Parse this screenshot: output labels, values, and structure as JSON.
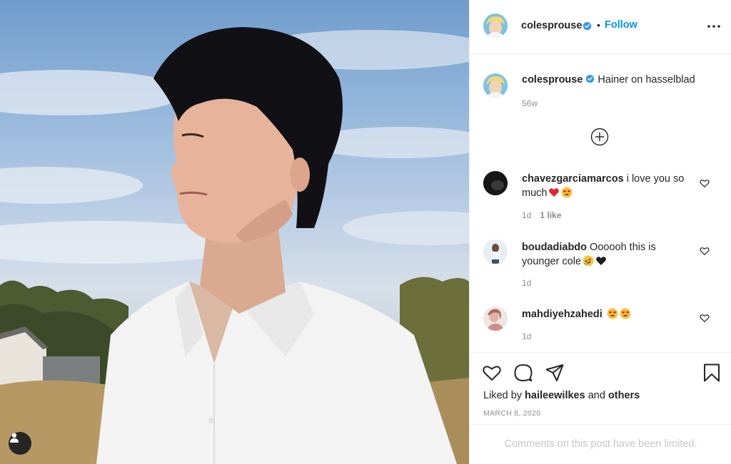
{
  "post": {
    "author": "colesprouse",
    "follow_label": "Follow",
    "separator": "•",
    "caption_text": "Hainer on hasselblad",
    "caption_age": "56w"
  },
  "comments": [
    {
      "username": "chavezgarciamarcos",
      "text": "i love you so much",
      "emojis": [
        "red-heart",
        "heart-eyes"
      ],
      "age": "1d",
      "likes": "1 like"
    },
    {
      "username": "boudadiabdo",
      "text": "Oooooh this is younger cole",
      "emojis": [
        "rolling-laughing",
        "black-heart"
      ],
      "age": "1d",
      "likes": ""
    },
    {
      "username": "mahdiyehzahedi",
      "text": "",
      "emojis": [
        "heart-eyes",
        "heart-eyes"
      ],
      "age": "1d",
      "likes": ""
    }
  ],
  "actions": {
    "liked_by_prefix": "Liked by",
    "liked_by_user": "haileewilkes",
    "liked_by_and": "and",
    "liked_by_others": "others",
    "date": "MARCH 8, 2020",
    "comments_limited": "Comments on this post have been limited."
  },
  "icons": [
    "verified-badge-icon",
    "more-options-icon",
    "load-more-comments-icon",
    "heart-icon",
    "comment-icon",
    "share-icon",
    "save-icon",
    "user-tag-icon"
  ],
  "colors": {
    "link": "#0095f6",
    "verified": "#3897f0",
    "muted": "#8e8e8e",
    "text": "#262626"
  }
}
